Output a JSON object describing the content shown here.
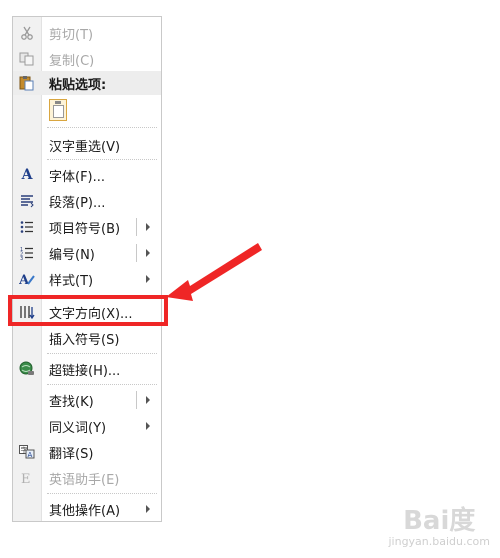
{
  "menu": {
    "items": [
      {
        "label": "剪切(T)",
        "icon": "scissors-icon",
        "disabled": true
      },
      {
        "label": "复制(C)",
        "icon": "copy-icon",
        "disabled": true
      },
      {
        "label": "粘贴选项:",
        "icon": "paste-icon",
        "header": true
      },
      {
        "label": "汉字重选(V)"
      },
      {
        "label": "字体(F)...",
        "icon": "font-icon"
      },
      {
        "label": "段落(P)...",
        "icon": "paragraph-icon"
      },
      {
        "label": "项目符号(B)",
        "icon": "bullets-icon",
        "submenu": true
      },
      {
        "label": "编号(N)",
        "icon": "numbering-icon",
        "submenu": true
      },
      {
        "label": "样式(T)",
        "icon": "styles-icon",
        "submenu": true
      },
      {
        "label": "文字方向(X)...",
        "icon": "text-direction-icon"
      },
      {
        "label": "插入符号(S)"
      },
      {
        "label": "超链接(H)...",
        "icon": "hyperlink-icon"
      },
      {
        "label": "查找(K)",
        "submenu": true
      },
      {
        "label": "同义词(Y)",
        "submenu": true
      },
      {
        "label": "翻译(S)",
        "icon": "translate-icon"
      },
      {
        "label": "英语助手(E)",
        "icon": "english-assistant-icon",
        "disabled": true
      },
      {
        "label": "其他操作(A)",
        "submenu": true
      }
    ]
  },
  "highlight_color": "#ef2626",
  "watermark": {
    "top": "Bai度",
    "bottom": "jingyan.baidu.com"
  }
}
